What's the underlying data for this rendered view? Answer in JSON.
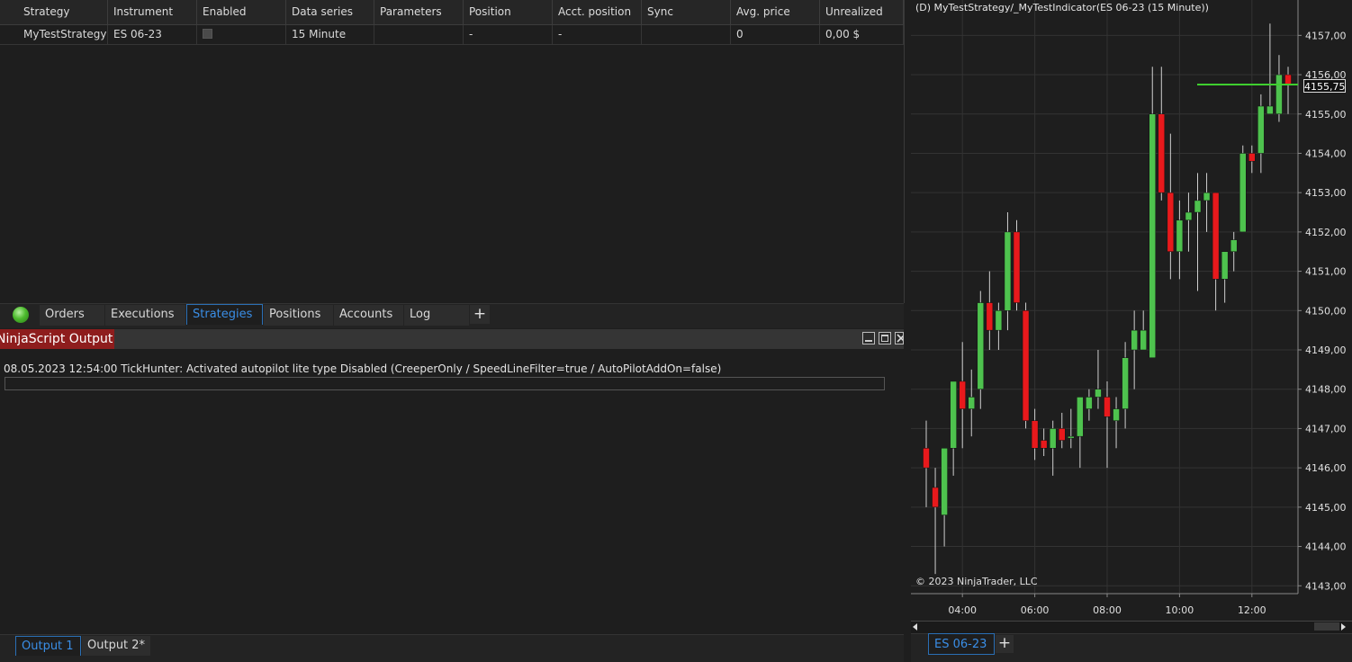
{
  "grid": {
    "headers": [
      "Strategy",
      "Instrument",
      "Enabled",
      "Data series",
      "Parameters",
      "Position",
      "Acct. position",
      "Sync",
      "Avg. price",
      "Unrealized"
    ],
    "row": {
      "strategy": "MyTestStrategy",
      "instrument": "ES 06-23",
      "data_series": "15 Minute",
      "parameters": "",
      "position": "-",
      "acct_position": "-",
      "sync": "",
      "avg_price": "0",
      "unrealized": "0,00 $"
    }
  },
  "tabs": [
    "Orders",
    "Executions",
    "Strategies",
    "Positions",
    "Accounts",
    "Log"
  ],
  "active_tab": "Strategies",
  "output": {
    "title": "NinjaScript Output",
    "line": "08.05.2023 12:54:00 TickHunter: Activated autopilot lite type Disabled (CreeperOnly / SpeedLineFilter=true / AutoPilotAddOn=false)",
    "tabs": [
      "Output 1",
      "Output 2*"
    ]
  },
  "chart": {
    "title": "(D) MyTestStrategy/_MyTestIndicator(ES 06-23 (15 Minute))",
    "copyright": "© 2023 NinjaTrader, LLC",
    "price_label": "4155,75",
    "tab": "ES 06-23",
    "add_tab": "+"
  },
  "chart_data": {
    "type": "candlestick",
    "instrument": "ES 06-23",
    "interval": "15 Minute",
    "ylim": [
      4142.8,
      4157.9
    ],
    "y_ticks": [
      "4157,00",
      "4156,00",
      "4155,00",
      "4154,00",
      "4153,00",
      "4152,00",
      "4151,00",
      "4150,00",
      "4149,00",
      "4148,00",
      "4147,00",
      "4146,00",
      "4145,00",
      "4144,00",
      "4143,00"
    ],
    "x_ticks": [
      "04:00",
      "06:00",
      "08:00",
      "10:00",
      "12:00"
    ],
    "up_color": "#4ec24e",
    "down_color": "#e8191c",
    "last_price": 4155.75,
    "candles": [
      {
        "o": 4146.5,
        "h": 4147.2,
        "l": 4145.0,
        "c": 4146.0
      },
      {
        "o": 4145.5,
        "h": 4146.0,
        "l": 4143.3,
        "c": 4145.0
      },
      {
        "o": 4144.8,
        "h": 4146.5,
        "l": 4144.0,
        "c": 4146.5
      },
      {
        "o": 4146.5,
        "h": 4148.0,
        "l": 4145.8,
        "c": 4148.2
      },
      {
        "o": 4148.2,
        "h": 4149.2,
        "l": 4146.5,
        "c": 4147.5
      },
      {
        "o": 4147.5,
        "h": 4148.5,
        "l": 4146.8,
        "c": 4147.8
      },
      {
        "o": 4148.0,
        "h": 4150.5,
        "l": 4147.5,
        "c": 4150.2
      },
      {
        "o": 4150.2,
        "h": 4151.0,
        "l": 4149.0,
        "c": 4149.5
      },
      {
        "o": 4149.5,
        "h": 4150.2,
        "l": 4149.0,
        "c": 4150.0
      },
      {
        "o": 4150.0,
        "h": 4152.5,
        "l": 4149.5,
        "c": 4152.0
      },
      {
        "o": 4152.0,
        "h": 4152.3,
        "l": 4150.0,
        "c": 4150.2
      },
      {
        "o": 4150.0,
        "h": 4150.2,
        "l": 4147.0,
        "c": 4147.2
      },
      {
        "o": 4147.2,
        "h": 4147.5,
        "l": 4146.2,
        "c": 4146.5
      },
      {
        "o": 4146.7,
        "h": 4147.0,
        "l": 4146.3,
        "c": 4146.5
      },
      {
        "o": 4146.5,
        "h": 4147.2,
        "l": 4145.8,
        "c": 4147.0
      },
      {
        "o": 4147.0,
        "h": 4147.4,
        "l": 4146.5,
        "c": 4146.7
      },
      {
        "o": 4146.8,
        "h": 4147.5,
        "l": 4146.5,
        "c": 4146.8
      },
      {
        "o": 4146.8,
        "h": 4147.8,
        "l": 4146.0,
        "c": 4147.8
      },
      {
        "o": 4147.5,
        "h": 4148.0,
        "l": 4147.2,
        "c": 4147.8
      },
      {
        "o": 4147.8,
        "h": 4149.0,
        "l": 4147.5,
        "c": 4148.0
      },
      {
        "o": 4147.8,
        "h": 4148.2,
        "l": 4146.0,
        "c": 4147.3
      },
      {
        "o": 4147.2,
        "h": 4147.8,
        "l": 4146.5,
        "c": 4147.5
      },
      {
        "o": 4147.5,
        "h": 4149.2,
        "l": 4147.0,
        "c": 4148.8
      },
      {
        "o": 4149.0,
        "h": 4150.0,
        "l": 4148.0,
        "c": 4149.5
      },
      {
        "o": 4149.0,
        "h": 4150.0,
        "l": 4149.0,
        "c": 4149.5
      },
      {
        "o": 4148.8,
        "h": 4156.2,
        "l": 4148.8,
        "c": 4155.0
      },
      {
        "o": 4155.0,
        "h": 4156.2,
        "l": 4152.8,
        "c": 4153.0
      },
      {
        "o": 4153.0,
        "h": 4154.5,
        "l": 4150.8,
        "c": 4151.5
      },
      {
        "o": 4151.5,
        "h": 4152.8,
        "l": 4150.8,
        "c": 4152.3
      },
      {
        "o": 4152.3,
        "h": 4153.0,
        "l": 4151.5,
        "c": 4152.5
      },
      {
        "o": 4152.5,
        "h": 4153.5,
        "l": 4150.5,
        "c": 4152.8
      },
      {
        "o": 4152.8,
        "h": 4153.5,
        "l": 4152.0,
        "c": 4153.0
      },
      {
        "o": 4153.0,
        "h": 4153.0,
        "l": 4150.0,
        "c": 4150.8
      },
      {
        "o": 4150.8,
        "h": 4151.5,
        "l": 4150.2,
        "c": 4151.5
      },
      {
        "o": 4151.5,
        "h": 4152.0,
        "l": 4151.0,
        "c": 4151.8
      },
      {
        "o": 4152.0,
        "h": 4154.2,
        "l": 4152.0,
        "c": 4154.0
      },
      {
        "o": 4154.0,
        "h": 4154.2,
        "l": 4153.5,
        "c": 4153.8
      },
      {
        "o": 4154.0,
        "h": 4155.5,
        "l": 4153.5,
        "c": 4155.2
      },
      {
        "o": 4155.0,
        "h": 4157.3,
        "l": 4155.0,
        "c": 4155.2
      },
      {
        "o": 4155.0,
        "h": 4156.5,
        "l": 4154.8,
        "c": 4156.0
      },
      {
        "o": 4156.0,
        "h": 4156.2,
        "l": 4155.0,
        "c": 4155.75
      }
    ]
  }
}
